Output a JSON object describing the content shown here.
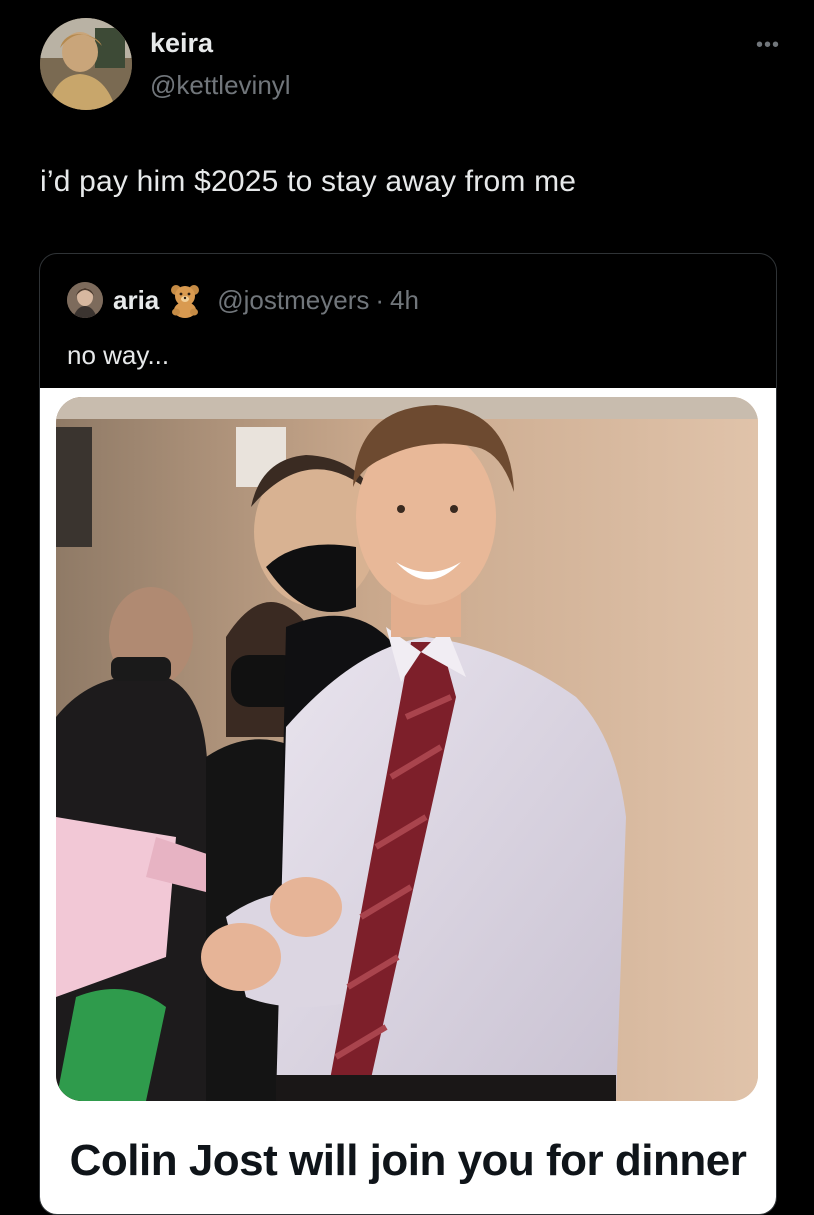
{
  "post": {
    "author_name": "keira",
    "author_handle": "@kettlevinyl",
    "text": "i’d pay him $2025 to stay away from me",
    "more_label": "•••"
  },
  "quote": {
    "author_name": "aria",
    "author_emoji": "teddy-bear",
    "author_handle": "@jostmeyers",
    "separator": "·",
    "time": "4h",
    "text": "no way...",
    "meme_caption": "Colin Jost will join you for dinner"
  },
  "colors": {
    "background": "#000000",
    "text_primary": "#e7e9ea",
    "text_secondary": "#71767b",
    "card_border": "#2f3336",
    "caption_text": "#0f1419"
  }
}
